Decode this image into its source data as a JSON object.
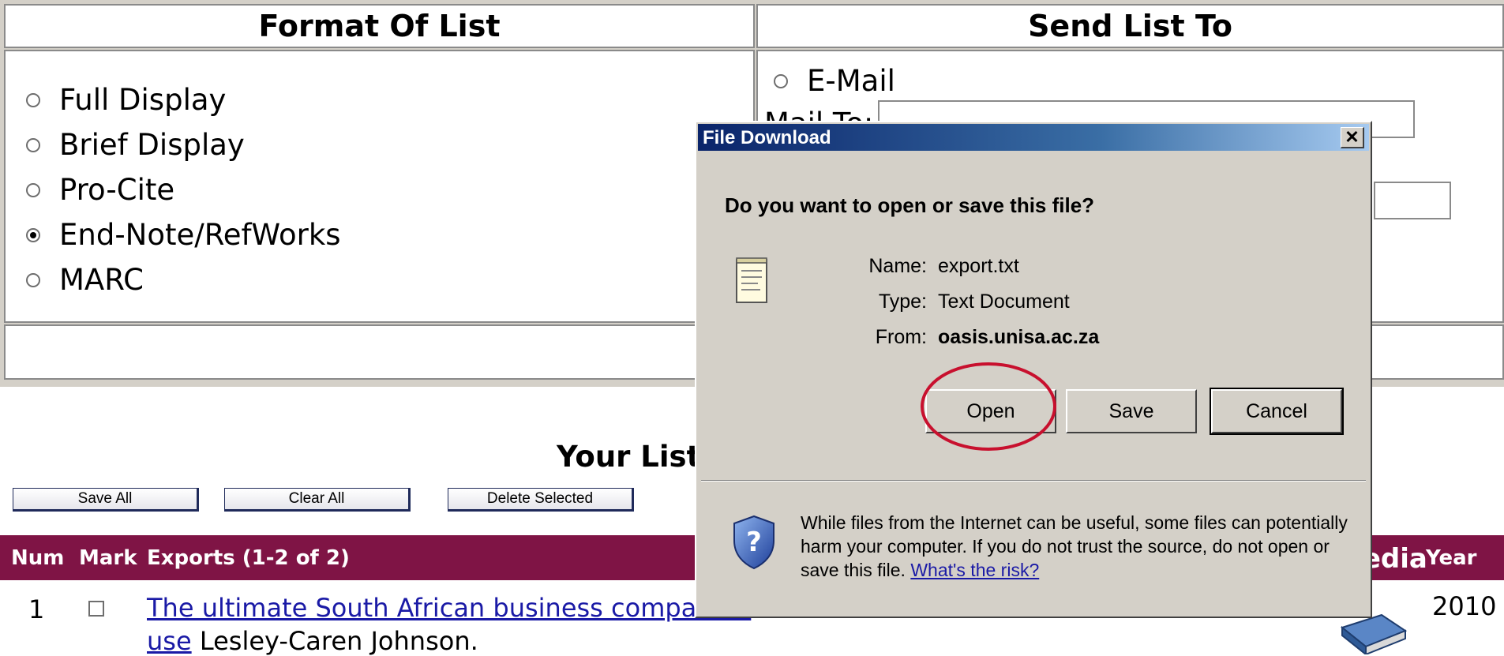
{
  "format_panel": {
    "header": "Format Of List",
    "options": [
      {
        "label": "Full Display",
        "checked": false
      },
      {
        "label": "Brief Display",
        "checked": false
      },
      {
        "label": "Pro-Cite",
        "checked": false
      },
      {
        "label": "End-Note/RefWorks",
        "checked": true
      },
      {
        "label": "MARC",
        "checked": false
      }
    ]
  },
  "send_panel": {
    "header": "Send List To",
    "email_label": "E-Mail",
    "mail_to_label": "Mail To:",
    "mail_to_value": ""
  },
  "list": {
    "title": "Your List",
    "buttons": {
      "save_all": "Save All",
      "clear_all": "Clear All",
      "delete_selected": "Delete Selected"
    },
    "columns": {
      "num": "Num",
      "mark": "Mark",
      "exports": "Exports (1-2 of 2)",
      "media": "Media",
      "year": "Year"
    },
    "rows": [
      {
        "num": "1",
        "title_line1": "The ultimate South African business companion",
        "title_line2": "use",
        "author": "Lesley-Caren Johnson.",
        "year": "2010"
      }
    ]
  },
  "dialog": {
    "title": "File Download",
    "close": "✕",
    "question": "Do you want to open or save this file?",
    "name_label": "Name:",
    "name_value": "export.txt",
    "type_label": "Type:",
    "type_value": "Text Document",
    "from_label": "From:",
    "from_value": "oasis.unisa.ac.za",
    "open": "Open",
    "save": "Save",
    "cancel": "Cancel",
    "warning": "While files from the Internet can be useful, some files can potentially harm your computer. If you do not trust the source, do not open or save this file.",
    "risk_link": "What's the risk?"
  },
  "colors": {
    "maroon": "#7f1445",
    "highlight": "#c8102e",
    "link": "#1a1aa6"
  }
}
